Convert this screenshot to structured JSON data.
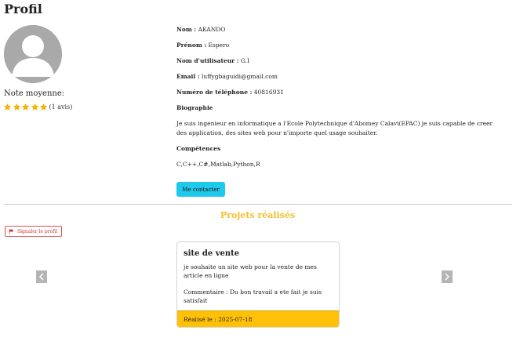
{
  "page": {
    "title": "Profil"
  },
  "rating": {
    "label": "Note moyenne:",
    "stars": 5,
    "count_text": "(1 avis)",
    "star_color": "#f5b301"
  },
  "profile": {
    "nom_label": "Nom :",
    "nom": "AKANDO",
    "prenom_label": "Prénom :",
    "prenom": "Espero",
    "username_label": "Nom d'utilisateur :",
    "username": "G.I",
    "email_label": "Email :",
    "email": "luffygbaguidi@gmail.com",
    "phone_label": "Numéro de téléphone :",
    "phone": "40816931",
    "bio_title": "Biographie",
    "bio": "Je suis ingenieur en informatique a l'Ecole Polytechnique d'Abomey Calavi(EPAC) je suis capable de creer des application, des sites web pour n'importe quel usage souhaiter.",
    "skills_title": "Compétences",
    "skills": "C,C++,C#,Matlab,Python,R"
  },
  "actions": {
    "contact_label": "Me contacter",
    "report_label": "Signaler le profil"
  },
  "projects": {
    "title": "Projets réalisés",
    "items": [
      {
        "name": "site de vente",
        "description": "je souhaite un site web pour la vente de mes article en ligne",
        "comment": "Commentaire : Du bon travail a ete fait je suis satisfait",
        "completed": "Réalisé le : 2025-07-18"
      }
    ]
  },
  "colors": {
    "accent_cyan": "#1ec9ec",
    "projects_title": "#f2c12e",
    "card_footer": "#ffc107",
    "report_red": "#c9302c"
  },
  "icons": {
    "avatar": "user-avatar-icon",
    "star": "star-icon",
    "flag": "flag-icon",
    "prev": "chevron-left-icon",
    "next": "chevron-right-icon"
  }
}
